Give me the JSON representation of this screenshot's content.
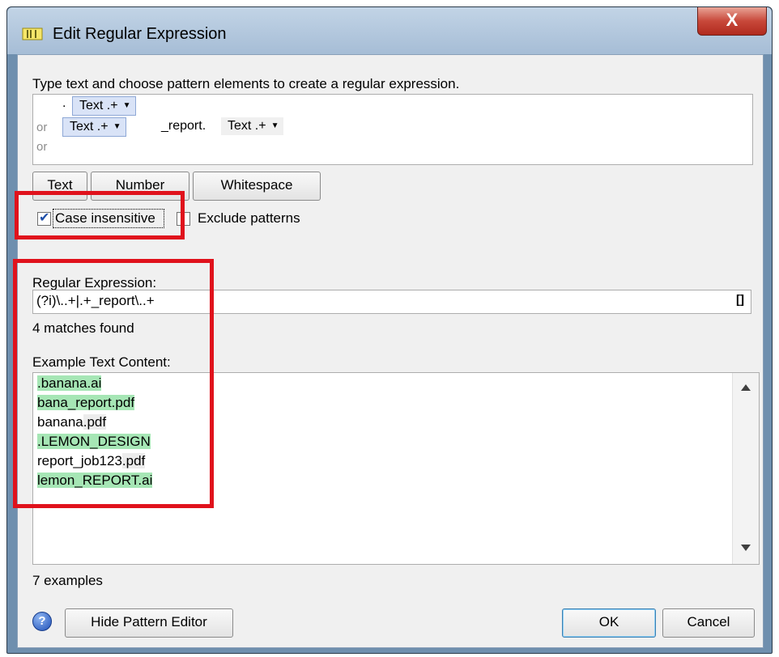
{
  "window": {
    "title": "Edit Regular Expression",
    "close_glyph": "X",
    "app_icon": "pattern-editor-icon"
  },
  "instructions": "Type text and choose pattern elements to create a regular expression.",
  "pattern": {
    "row1": {
      "literal": ".",
      "chip": "Text .+"
    },
    "row2": {
      "or": "or",
      "chip1": "Text .+",
      "literal": "_report.",
      "chip2": "Text .+"
    },
    "row3": {
      "or": "or"
    },
    "chip_arrow": "▼"
  },
  "element_buttons": {
    "text": "Text",
    "number": "Number",
    "whitespace": "Whitespace"
  },
  "options": {
    "case_insensitive": {
      "label": "Case insensitive",
      "checked": true
    },
    "exclude_patterns": {
      "label": "Exclude patterns",
      "checked": false
    }
  },
  "regex": {
    "label": "Regular Expression:",
    "value": "(?i)\\..+|.+_report\\..+",
    "copy_glyph": "[]",
    "matches": "4 matches found"
  },
  "examples": {
    "label": "Example Text Content:",
    "lines": [
      {
        "text": ".banana.ai",
        "match": true
      },
      {
        "text": "bana_report.pdf",
        "match": true
      },
      {
        "pre": "banana",
        "post": ".pdf",
        "match": false
      },
      {
        "text": ".LEMON_DESIGN",
        "match": true
      },
      {
        "pre": "report_job123",
        "post": ".pdf",
        "match": false
      },
      {
        "text": "lemon_REPORT.ai",
        "match": true
      }
    ],
    "count": "7 examples"
  },
  "footer": {
    "help_glyph": "?",
    "hide_pattern_editor": "Hide Pattern Editor",
    "ok": "OK",
    "cancel": "Cancel"
  },
  "colors": {
    "match_highlight": "#a6e6b5",
    "annotation_red": "#e0121c",
    "chip_selected": "#d9e3f7"
  }
}
